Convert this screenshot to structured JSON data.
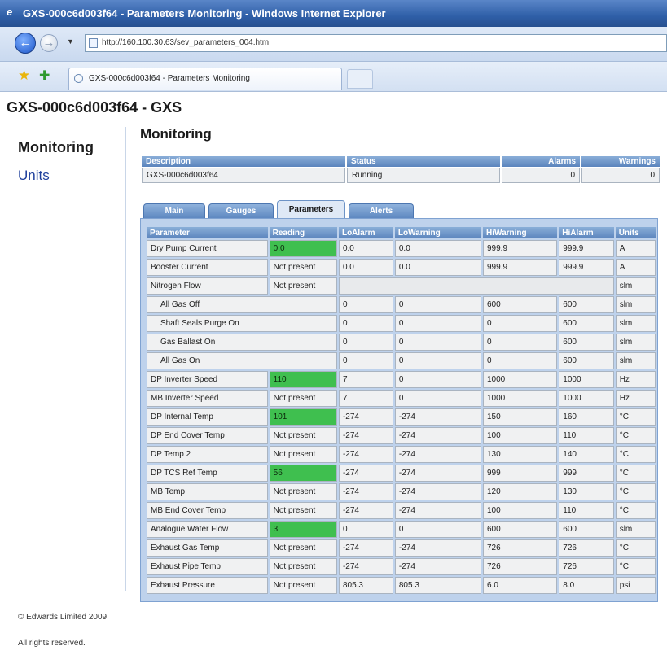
{
  "window": {
    "title": "GXS-000c6d003f64 - Parameters Monitoring - Windows Internet Explorer",
    "url": "http://160.100.30.63/sev_parameters_004.htm",
    "tab_title": "GXS-000c6d003f64 - Parameters Monitoring"
  },
  "page": {
    "title": "GXS-000c6d003f64 - GXS",
    "section_title": "Monitoring"
  },
  "sidebar": {
    "monitoring": "Monitoring",
    "units": "Units"
  },
  "summary": {
    "headers": [
      "Description",
      "Status",
      "Alarms",
      "Warnings"
    ],
    "row": [
      "GXS-000c6d003f64",
      "Running",
      "0",
      "0"
    ]
  },
  "tabs": [
    "Main",
    "Gauges",
    "Parameters",
    "Alerts"
  ],
  "active_tab": "Parameters",
  "parameters": {
    "headers": [
      "Parameter",
      "Reading",
      "LoAlarm",
      "LoWarning",
      "HiWarning",
      "HiAlarm",
      "Units"
    ],
    "rows": [
      {
        "name": "Dry Pump Current",
        "reading": "0.0",
        "lo_alarm": "0.0",
        "lo_warning": "0.0",
        "hi_warning": "999.9",
        "hi_alarm": "999.9",
        "units": "A",
        "ok": true
      },
      {
        "name": "Booster Current",
        "reading": "Not present",
        "lo_alarm": "0.0",
        "lo_warning": "0.0",
        "hi_warning": "999.9",
        "hi_alarm": "999.9",
        "units": "A",
        "ok": false
      },
      {
        "name": "Nitrogen Flow",
        "reading": "Not present",
        "lo_alarm": "",
        "lo_warning": "",
        "hi_warning": "",
        "hi_alarm": "",
        "units": "slm",
        "ok": false
      },
      {
        "name": "All Gas Off",
        "reading": "",
        "lo_alarm": "0",
        "lo_warning": "0",
        "hi_warning": "600",
        "hi_alarm": "600",
        "units": "slm",
        "ok": false
      },
      {
        "name": "Shaft Seals Purge On",
        "reading": "",
        "lo_alarm": "0",
        "lo_warning": "0",
        "hi_warning": "0",
        "hi_alarm": "600",
        "units": "slm",
        "ok": false
      },
      {
        "name": "Gas Ballast On",
        "reading": "",
        "lo_alarm": "0",
        "lo_warning": "0",
        "hi_warning": "0",
        "hi_alarm": "600",
        "units": "slm",
        "ok": false
      },
      {
        "name": "All Gas On",
        "reading": "",
        "lo_alarm": "0",
        "lo_warning": "0",
        "hi_warning": "0",
        "hi_alarm": "600",
        "units": "slm",
        "ok": false
      },
      {
        "name": "DP Inverter Speed",
        "reading": "110",
        "lo_alarm": "7",
        "lo_warning": "0",
        "hi_warning": "1000",
        "hi_alarm": "1000",
        "units": "Hz",
        "ok": true
      },
      {
        "name": "MB Inverter Speed",
        "reading": "Not present",
        "lo_alarm": "7",
        "lo_warning": "0",
        "hi_warning": "1000",
        "hi_alarm": "1000",
        "units": "Hz",
        "ok": false
      },
      {
        "name": "DP Internal Temp",
        "reading": "101",
        "lo_alarm": "-274",
        "lo_warning": "-274",
        "hi_warning": "150",
        "hi_alarm": "160",
        "units": "°C",
        "ok": true
      },
      {
        "name": "DP End Cover Temp",
        "reading": "Not present",
        "lo_alarm": "-274",
        "lo_warning": "-274",
        "hi_warning": "100",
        "hi_alarm": "110",
        "units": "°C",
        "ok": false
      },
      {
        "name": "DP Temp 2",
        "reading": "Not present",
        "lo_alarm": "-274",
        "lo_warning": "-274",
        "hi_warning": "130",
        "hi_alarm": "140",
        "units": "°C",
        "ok": false
      },
      {
        "name": "DP TCS Ref Temp",
        "reading": "56",
        "lo_alarm": "-274",
        "lo_warning": "-274",
        "hi_warning": "999",
        "hi_alarm": "999",
        "units": "°C",
        "ok": true
      },
      {
        "name": "MB Temp",
        "reading": "Not present",
        "lo_alarm": "-274",
        "lo_warning": "-274",
        "hi_warning": "120",
        "hi_alarm": "130",
        "units": "°C",
        "ok": false
      },
      {
        "name": "MB End Cover Temp",
        "reading": "Not present",
        "lo_alarm": "-274",
        "lo_warning": "-274",
        "hi_warning": "100",
        "hi_alarm": "110",
        "units": "°C",
        "ok": false
      },
      {
        "name": "Analogue Water Flow",
        "reading": "3",
        "lo_alarm": "0",
        "lo_warning": "0",
        "hi_warning": "600",
        "hi_alarm": "600",
        "units": "slm",
        "ok": true
      },
      {
        "name": "Exhaust Gas Temp",
        "reading": "Not present",
        "lo_alarm": "-274",
        "lo_warning": "-274",
        "hi_warning": "726",
        "hi_alarm": "726",
        "units": "°C",
        "ok": false
      },
      {
        "name": "Exhaust Pipe Temp",
        "reading": "Not present",
        "lo_alarm": "-274",
        "lo_warning": "-274",
        "hi_warning": "726",
        "hi_alarm": "726",
        "units": "°C",
        "ok": false
      },
      {
        "name": "Exhaust Pressure",
        "reading": "Not present",
        "lo_alarm": "805.3",
        "lo_warning": "805.3",
        "hi_warning": "6.0",
        "hi_alarm": "8.0",
        "units": "psi",
        "ok": false
      }
    ]
  },
  "footer": {
    "copyright": "© Edwards Limited 2009.",
    "rights": "All rights reserved."
  },
  "colors": {
    "titlebar": "#2f5fa8",
    "header_blue": "#5b84bd",
    "panel_blue": "#bed2ec",
    "reading_ok_green": "#3fbf4f",
    "link_blue": "#1e3f9c"
  },
  "icons": {
    "back": "back-arrow-icon",
    "forward": "forward-arrow-icon",
    "favorites": "star-icon",
    "add_favorites": "add-favorite-icon"
  }
}
